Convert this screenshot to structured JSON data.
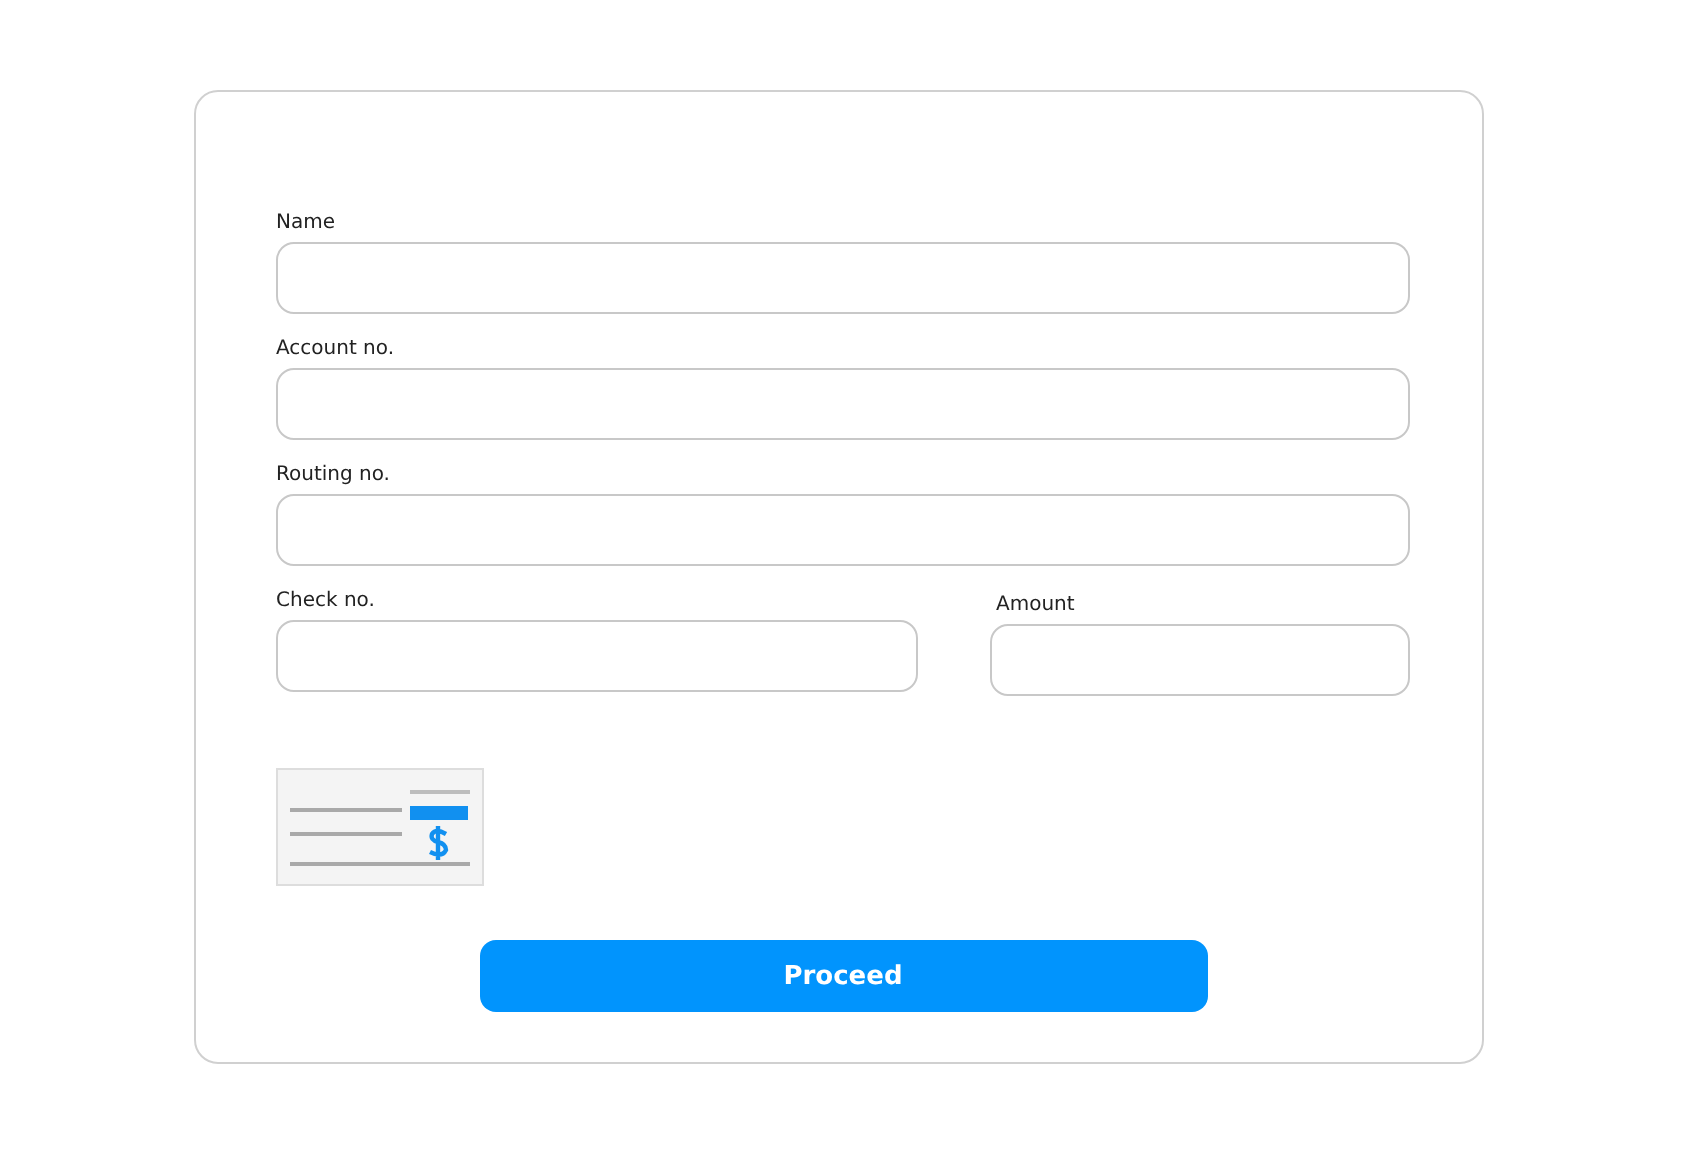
{
  "form": {
    "fields": [
      {
        "label": "Name"
      },
      {
        "label": "Account no."
      },
      {
        "label": "Routing no."
      }
    ],
    "row_fields": [
      {
        "label": "Check no."
      },
      {
        "label": "Amount"
      }
    ],
    "submit": {
      "label": "Proceed"
    }
  }
}
